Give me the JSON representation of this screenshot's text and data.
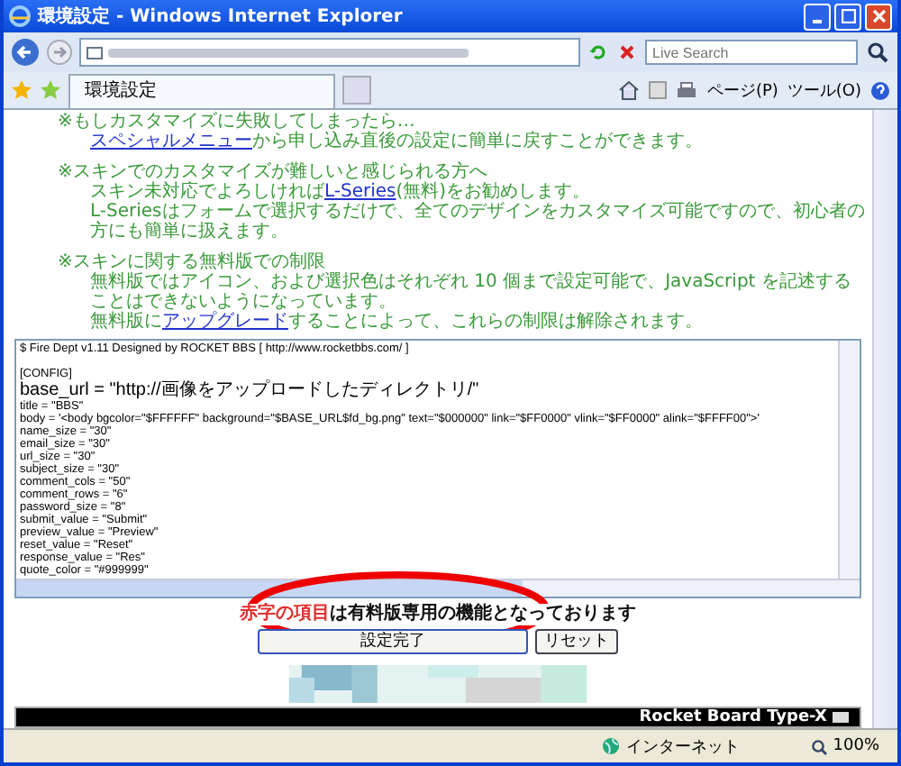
{
  "window": {
    "title": "環境設定 - Windows Internet Explorer"
  },
  "search": {
    "placeholder": "Live Search"
  },
  "tabs": [
    {
      "label": "環境設定",
      "selected": true
    }
  ],
  "toolbar_menus": [
    "ページ(P)",
    "ツール(O)"
  ],
  "notes": [
    {
      "kind": "heading",
      "parts": [
        {
          "text": "※もしカスタマイズに失敗してしまったら…"
        }
      ]
    },
    {
      "kind": "body",
      "parts": [
        {
          "text": "スペシャルメニュー",
          "link": true
        },
        {
          "text": "から申し込み直後の設定に簡単に戻すことができます。"
        }
      ]
    },
    {
      "kind": "heading",
      "parts": [
        {
          "text": "※スキンでのカスタマイズが難しいと感じられる方へ"
        }
      ]
    },
    {
      "kind": "body",
      "parts": [
        {
          "text": "スキン未対応でよろしければ"
        },
        {
          "text": "L-Series",
          "link": true
        },
        {
          "text": "(無料)をお勧めします。"
        }
      ]
    },
    {
      "kind": "body",
      "parts": [
        {
          "text": "L-Seriesはフォームで選択するだけで、全てのデザインをカスタマイズ可能ですので、初心者の方にも簡単に扱えます。"
        }
      ]
    },
    {
      "kind": "heading",
      "parts": [
        {
          "text": "※スキンに関する無料版での制限"
        }
      ]
    },
    {
      "kind": "body",
      "parts": [
        {
          "text": "無料版ではアイコン、および選択色はそれぞれ 10 個まで設定可能で、JavaScript を記述することはできないようになっています。"
        }
      ]
    },
    {
      "kind": "body",
      "parts": [
        {
          "text": "無料版に"
        },
        {
          "text": "アップグレード",
          "link": true
        },
        {
          "text": "することによって、これらの制限は解除されます。"
        }
      ]
    }
  ],
  "config_editor": {
    "header_line": "$ Fire Dept v1.11 Designed by ROCKET BBS [ http://www.rocketbbs.com/ ]",
    "lines": [
      "[CONFIG]",
      "base_url = \"http://画像をアップロードしたディレクトリ/\"",
      "title = \"BBS\"",
      "body = '<body bgcolor=\"$FFFFFF\" background=\"$BASE_URL$fd_bg.png\" text=\"$000000\" link=\"$FF0000\" vlink=\"$FF0000\" alink=\"$FFFF00\">'",
      "name_size = \"30\"",
      "email_size = \"30\"",
      "url_size = \"30\"",
      "subject_size = \"30\"",
      "comment_cols = \"50\"",
      "comment_rows = \"6\"",
      "password_size = \"8\"",
      "submit_value = \"Submit\"",
      "preview_value = \"Preview\"",
      "reset_value = \"Reset\"",
      "response_value = \"Res\"",
      "quote_color = \"#999999\""
    ]
  },
  "notice": {
    "highlight": "赤字の項目",
    "text": "は有料版専用の機能となっております"
  },
  "buttons": [
    {
      "label": "設定完了",
      "kind": "primary"
    },
    {
      "label": "リセット",
      "kind": "secondary"
    }
  ],
  "footer": {
    "text": "Rocket Board Type-X"
  },
  "status_bar": {
    "zone": "インターネット",
    "zoom": "100%"
  }
}
